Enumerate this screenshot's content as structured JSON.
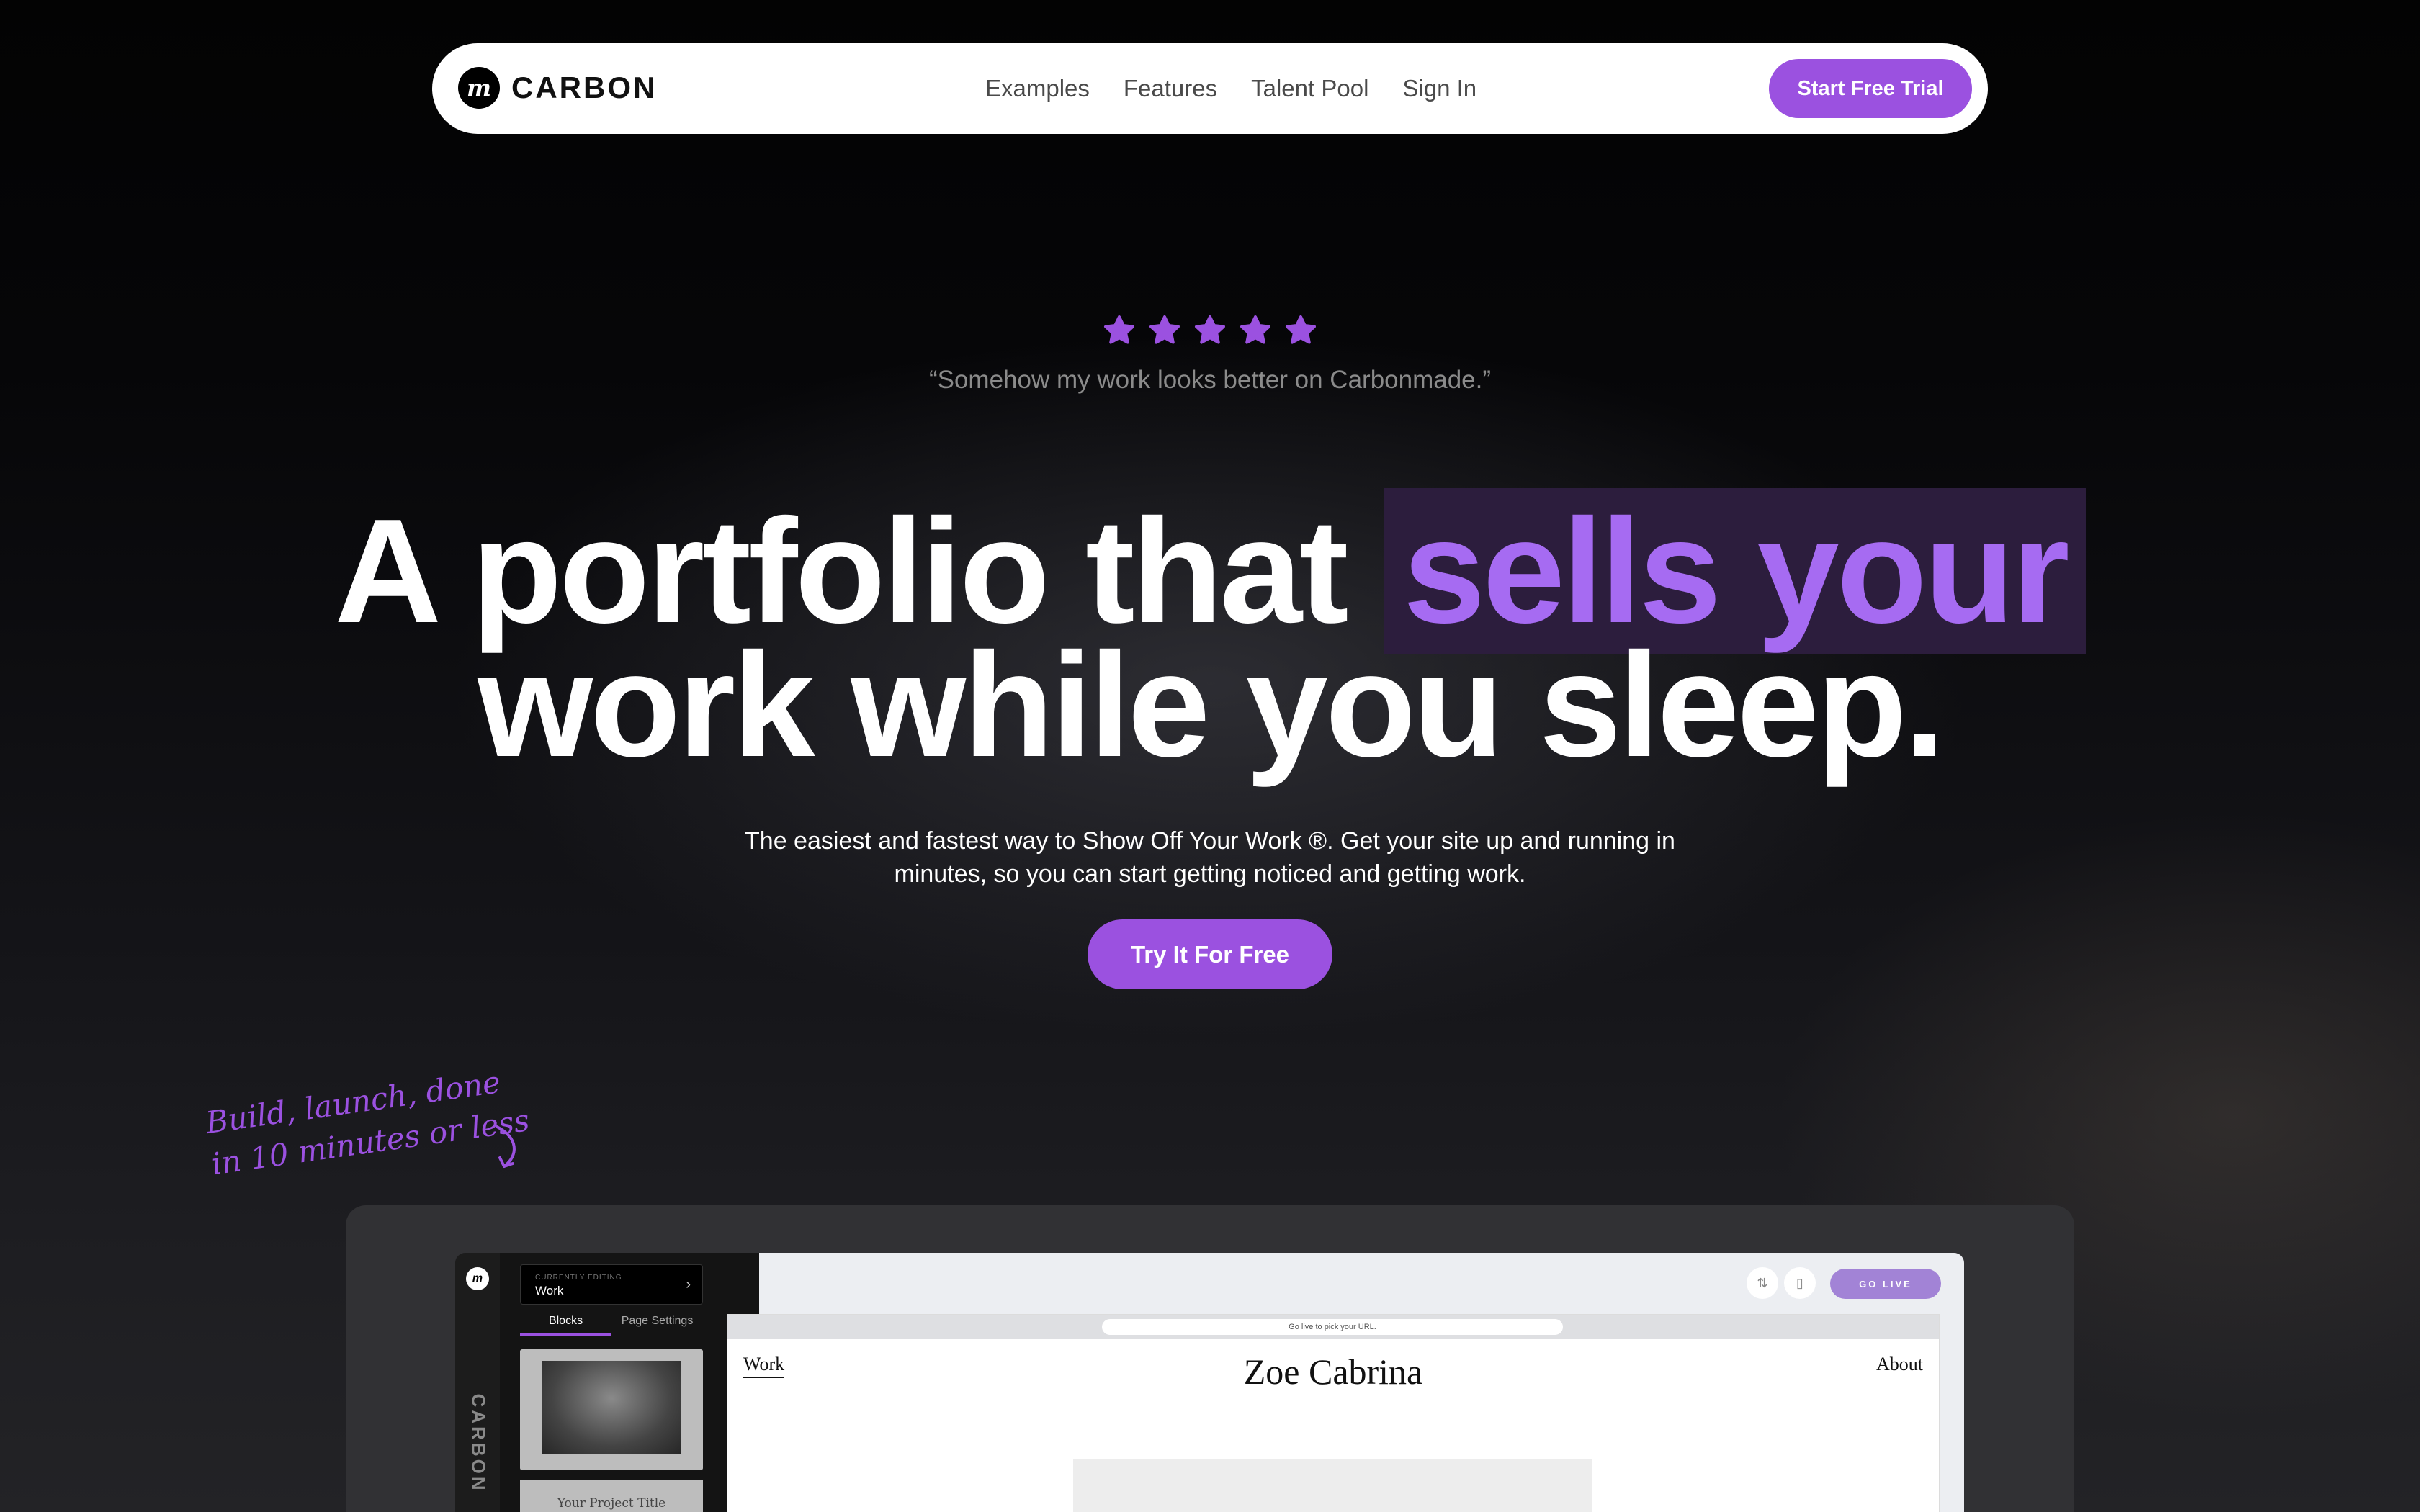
{
  "nav": {
    "logo_text": "CARBON",
    "logo_mark": "m",
    "links": [
      "Examples",
      "Features",
      "Talent Pool",
      "Sign In"
    ],
    "cta": "Start Free Trial"
  },
  "hero": {
    "rating": 5,
    "quote": "“Somehow my work looks better on Carbonmade.”",
    "headline_part1": "A portfolio that",
    "headline_highlight": "sells your",
    "headline_line2": "work while you sleep.",
    "subtitle": "The easiest and fastest way to Show Off Your Work ®. Get your site up and running in minutes, so you can start getting noticed and getting work.",
    "cta": "Try It For Free",
    "note_line1": "Build, launch, done",
    "note_line2": "in 10 minutes or less"
  },
  "preview": {
    "rail_logo": "m",
    "rail_text": "CARBON",
    "currently_editing_label": "CURRENTLY EDITING",
    "currently_editing_value": "Work",
    "tabs": [
      "Blocks",
      "Page Settings"
    ],
    "project_title": "Your Project Title",
    "go_live": "GO LIVE",
    "url_hint": "Go live to pick your URL.",
    "site_nav_work": "Work",
    "site_name": "Zoe Cabrina",
    "site_nav_about": "About"
  },
  "colors": {
    "accent": "#9b51e0",
    "highlight_text": "#a66bf2",
    "highlight_bg": "#2c1d3d"
  }
}
